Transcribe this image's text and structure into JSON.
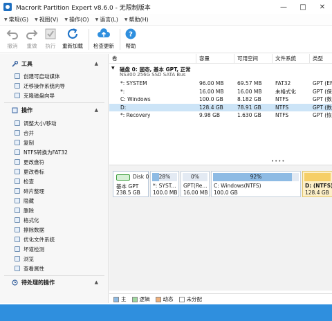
{
  "window": {
    "title": "Macrorit Partition Expert v8.6.0 - 无限制版本"
  },
  "menu": [
    "常规(G)",
    "视图(V)",
    "操作(O)",
    "语言(L)",
    "帮助(H)"
  ],
  "toolbar": {
    "undo": "撤消",
    "redo": "重做",
    "execute": "执行",
    "reload": "重新加载",
    "check_update": "检查更新",
    "help": "帮助"
  },
  "sidebar": {
    "tools_header": "工具",
    "tools": [
      "创建可启动媒体",
      "迁移操作系统向导",
      "克隆磁盘向导"
    ],
    "operations_header": "操作",
    "operations": [
      "调整大小/移动",
      "合并",
      "复制",
      "NTFS转换为FAT32",
      "更改盘符",
      "更改卷标",
      "检查",
      "碎片整理",
      "隐藏",
      "删除",
      "格式化",
      "擦除数据",
      "优化文件系统",
      "坏道检测",
      "浏览",
      "查看属性"
    ],
    "pending_header": "待处理的操作"
  },
  "table": {
    "headers": [
      "卷",
      "容量",
      "可用空间",
      "文件系统",
      "类型"
    ],
    "disk_title": "磁盘 0: 固态, 基本 GPT, 正常",
    "disk_model": "NS300 256G SSD SATA Bus",
    "rows": [
      {
        "volume": "*: SYSTEM",
        "capacity": "96.00 MB",
        "free": "69.57 MB",
        "fs": "FAT32",
        "type": "GPT (EF"
      },
      {
        "volume": "*:",
        "capacity": "16.00 MB",
        "free": "16.00 MB",
        "fs": "未格式化",
        "type": "GPT (保"
      },
      {
        "volume": "C: Windows",
        "capacity": "100.0 GB",
        "free": "8.182 GB",
        "fs": "NTFS",
        "type": "GPT (数"
      },
      {
        "volume": "D:",
        "capacity": "128.4 GB",
        "free": "78.91 GB",
        "fs": "NTFS",
        "type": "GPT (数"
      },
      {
        "volume": "*: Recovery",
        "capacity": "9.98 GB",
        "free": "1.630 GB",
        "fs": "NTFS",
        "type": "GPT (恢"
      }
    ],
    "selected_row": 3
  },
  "disk_map": {
    "disk_label": "Disk 0",
    "disk_type": "基本 GPT",
    "disk_size": "238.5 GB",
    "partitions": [
      {
        "usage": "28%",
        "fill": 0.28,
        "label": "*: SYST...",
        "size": "100.0 MB"
      },
      {
        "usage": "0%",
        "fill": 0.0,
        "label": "GPT(Re...",
        "size": "16.00 MB"
      },
      {
        "usage": "92%",
        "fill": 0.92,
        "label": "C: Windows(NTFS)",
        "size": "100.0 GB"
      },
      {
        "usage": "",
        "fill": 1.0,
        "label": "D: (NTFS)",
        "size": "128.4 GB"
      }
    ],
    "selected_partition": 3
  },
  "legend": [
    {
      "label": "主",
      "color": "#8ebbe4"
    },
    {
      "label": "逻辑",
      "color": "#9fd89f"
    },
    {
      "label": "动态",
      "color": "#f0b07a"
    },
    {
      "label": "未分配",
      "color": "#ffffff"
    }
  ],
  "colors": {
    "accent": "#2f8fde",
    "selection": "#cce4f7",
    "active_partition": "#f6cf67"
  }
}
